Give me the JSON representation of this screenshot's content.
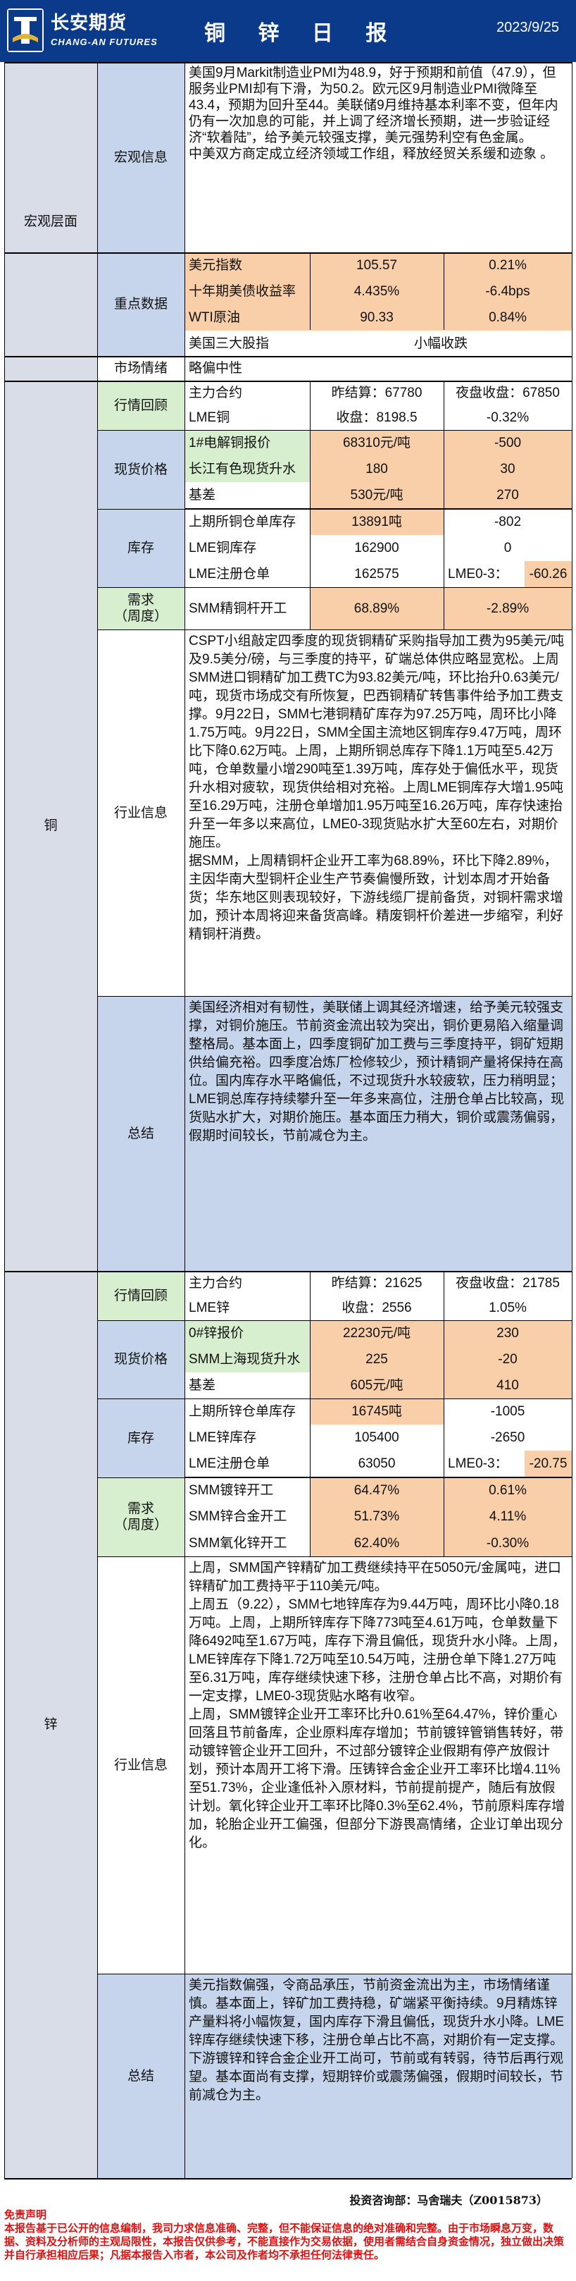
{
  "header": {
    "company": "长安期货",
    "company_en": "CHANG-AN FUTURES",
    "title": "铜 锌 日 报",
    "date": "2023/9/25"
  },
  "macro": {
    "section": "宏观层面",
    "info_label": "宏观信息",
    "info_text": "美国9月Markit制造业PMI为48.9，好于预期和前值（47.9），但服务业PMI却有下滑，为50.2。欧元区9月制造业PMI微降至43.4，预期为回升至44。美联储9月维持基本利率不变，但年内仍有一次加息的可能，并上调了经济增长预期，进一步验证经济“软着陆”，给予美元较强支撑，美元强势利空有色金属。\n中美双方商定成立经济领域工作组，释放经贸关系缓和迹象 。",
    "key_label": "重点数据",
    "rows": [
      {
        "name": "美元指数",
        "value": "105.57",
        "change": "0.21%"
      },
      {
        "name": "十年期美债收益率",
        "value": "4.435%",
        "change": "-6.4bps"
      },
      {
        "name": "WTI原油",
        "value": "90.33",
        "change": "0.84%"
      },
      {
        "name": "美国三大股指",
        "value": "小幅收跌"
      }
    ],
    "sentiment_label": "市场情绪",
    "sentiment": "略偏中性"
  },
  "copper": {
    "section": "铜",
    "quote_label": "行情回顾",
    "quote_rows": [
      {
        "c1": "主力合约",
        "c2": "昨结算：67780",
        "c3": "夜盘收盘：67850"
      },
      {
        "c1": "LME铜",
        "c2": "收盘：8198.5",
        "c3": "-0.32%"
      }
    ],
    "spot_label": "现货价格",
    "spot_rows": [
      {
        "c1": "1#电解铜报价",
        "c2": "68310元/吨",
        "c3": "-500"
      },
      {
        "c1": "长江有色现货升水",
        "c2": "180",
        "c3": "30"
      },
      {
        "c1": "基差",
        "c2": "530元/吨",
        "c3": "270"
      }
    ],
    "inv_label": "库存",
    "inv_rows": [
      {
        "c1": "上期所铜仓单库存",
        "c2": "13891吨",
        "c3": "-802"
      },
      {
        "c1": "LME铜库存",
        "c2": "162900",
        "c3": "0"
      },
      {
        "c1": "LME注册仓单",
        "c2": "162575",
        "c3a": "LME0-3：",
        "c3b": "-60.26"
      }
    ],
    "demand_label": "需求\n（周度）",
    "demand_rows": [
      {
        "c1": "SMM精铜杆开工",
        "c2": "68.89%",
        "c3": "-2.89%"
      }
    ],
    "industry_label": "行业信息",
    "industry_text": "CSPT小组敲定四季度的现货铜精矿采购指导加工费为95美元/吨及9.5美分/磅，与三季度的持平，矿端总体供应略显宽松。上周SMM进口铜精矿加工费TC为93.82美元/吨，环比抬升0.63美元/吨，现货市场成交有所恢复，巴西铜精矿转售事件给予加工费支撑。9月22日，SMM七港铜精矿库存为97.25万吨，周环比小降1.75万吨。9月22日，SMM全国主流地区铜库存9.47万吨，周环比下降0.62万吨。上周，上期所铜总库存下降1.1万吨至5.42万吨，仓单数量小增290吨至1.39万吨，库存处于偏低水平，现货升水相对疲软，现货供给相对充裕。上周LME铜库存大增1.95吨至16.29万吨，注册仓单增加1.95万吨至16.26万吨，库存快速抬升至一年多以来高位，LME0-3现货贴水扩大至60左右，对期价施压。\n据SMM，上周精铜杆企业开工率为68.89%，环比下降2.89%，主因华南大型铜杆企业生产节奏偏慢所致，计划本周才开始备货；华东地区则表现较好，下游线缆厂提前备货，对铜杆需求增加，预计本周将迎来备货高峰。精废铜杆价差进一步缩窄，利好精铜杆消费。",
    "summary_label": "总结",
    "summary_text": "美国经济相对有韧性，美联储上调其经济增速，给予美元较强支撑，对铜价施压。节前资金流出较为突出，铜价更易陷入缩量调整格局。基本面上，四季度铜矿加工费与三季度持平，铜矿短期供给偏充裕。四季度冶炼厂检修较少，预计精铜产量将保持在高位。国内库存水平略偏低，不过现货升水较疲软，压力稍明显；LME铜总库存持续攀升至一年多来高位，注册仓单占比较高，现货贴水扩大，对期价施压。基本面压力稍大，铜价或震荡偏弱，假期时间较长，节前减仓为主。"
  },
  "zinc": {
    "section": "锌",
    "quote_label": "行情回顾",
    "quote_rows": [
      {
        "c1": "主力合约",
        "c2": "昨结算：21625",
        "c3": "夜盘收盘：21785"
      },
      {
        "c1": "LME锌",
        "c2": "收盘：2556",
        "c3": "1.05%"
      }
    ],
    "spot_label": "现货价格",
    "spot_rows": [
      {
        "c1": "0#锌报价",
        "c2": "22230元/吨",
        "c3": "230"
      },
      {
        "c1": "SMM上海现货升水",
        "c2": "225",
        "c3": "-20"
      },
      {
        "c1": "基差",
        "c2": "605元/吨",
        "c3": "410"
      }
    ],
    "inv_label": "库存",
    "inv_rows": [
      {
        "c1": "上期所锌仓单库存",
        "c2": "16745吨",
        "c3": "-1005"
      },
      {
        "c1": "LME锌库存",
        "c2": "105400",
        "c3": "-2650"
      },
      {
        "c1": "LME注册仓单",
        "c2": "63050",
        "c3a": "LME0-3：",
        "c3b": "-20.75"
      }
    ],
    "demand_label": "需求\n（周度）",
    "demand_rows": [
      {
        "c1": "SMM镀锌开工",
        "c2": "64.47%",
        "c3": "0.61%"
      },
      {
        "c1": "SMM锌合金开工",
        "c2": "51.73%",
        "c3": "4.11%"
      },
      {
        "c1": "SMM氧化锌开工",
        "c2": "62.40%",
        "c3": "-0.30%"
      }
    ],
    "industry_label": "行业信息",
    "industry_text": "上周，SMM国产锌精矿加工费继续持平在5050元/金属吨，进口锌精矿加工费持平于110美元/吨。\n上周五（9.22），SMM七地锌库存为9.44万吨，周环比小降0.18万吨。上周，上期所锌库存下降773吨至4.61万吨，仓单数量下降6492吨至1.67万吨，库存下滑且偏低，现货升水小降。上周，LME锌库存下降1.72万吨至10.54万吨，注册仓单下降1.27万吨至6.31万吨，库存继续快速下移，注册仓单占比不高，对期价有一定支撑，LME0-3现货贴水略有收窄。\n上周，SMM镀锌企业开工率环比升0.61%至64.47%，锌价重心回落且节前备库，企业原料库存增加；节前镀锌管销售转好，带动镀锌管企业开工回升，不过部分镀锌企业假期有停产放假计划，预计本周开工将下滑。压铸锌合金企业开工率环比增4.11%至51.73%，企业逢低补入原材料，节前提前提产，随后有放假计划。氧化锌企业开工率环比降0.3%至62.4%，节前原料库存增加，轮胎企业开工偏强，但部分下游畏高情绪，企业订单出现分化。",
    "summary_label": "总结",
    "summary_text": "美元指数偏强，令商品承压，节前资金流出为主，市场情绪谨慎。基本面上，锌矿加工费持稳，矿端紧平衡持续。9月精炼锌产量料将小幅恢复，国内库存下滑且偏低，现货升水小降。LME锌库存继续快速下移，注册仓单占比不高，对期价有一定支撑。下游镀锌和锌合金企业开工尚可，节前或有转弱，待节后再行观望。基本面尚有支撑，短期锌价或震荡偏强，假期时间较长，节前减仓为主。"
  },
  "footer": {
    "analyst": "投资咨询部：马舍瑞夫（Z0015873）",
    "disclaimer_title": "免责声明",
    "disclaimer": "本报告基于已公开的信息编制，我司力求信息准确、完整，但不能保证信息的绝对准确和完整。由于市场瞬息万变，数据、资料及分析师的主观局限性，本报告仅供参考，不能直接作为交易依据，使用者需结合自身资金情况，独立做出决策并自行承担相应后果；凡据本报告入市者，本公司及作者均不承担任何法律责任。"
  },
  "colors": {
    "header_bg": "#0c3a8a",
    "section_bg": "#d8dde8",
    "label_bg": "#c6d5ec",
    "green": "#d7eecf",
    "orange": "#f8cfa8",
    "disclaimer_red": "#d11"
  }
}
